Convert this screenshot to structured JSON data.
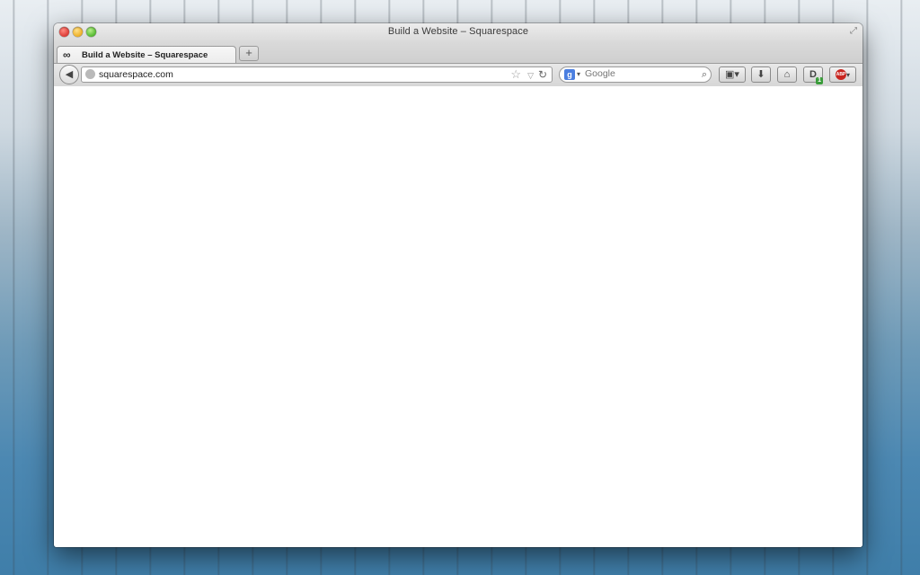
{
  "window": {
    "title": "Build a Website – Squarespace"
  },
  "tabs": [
    {
      "label": "Build a Website – Squarespace",
      "favicon": "squarespace-logo-icon"
    }
  ],
  "toolbar": {
    "url": "squarespace.com",
    "search_placeholder": "Google",
    "new_tab_label": "+",
    "dashlane_badge": "1",
    "abp_label": "ABP"
  },
  "icons": {
    "back": "back-arrow-icon",
    "star": "bookmark-star-icon",
    "reload": "reload-icon",
    "search_engine": "google-icon",
    "search": "magnifier-icon",
    "bookmarks": "bookmarks-menu-icon",
    "downloads": "download-arrow-icon",
    "home": "home-icon"
  }
}
